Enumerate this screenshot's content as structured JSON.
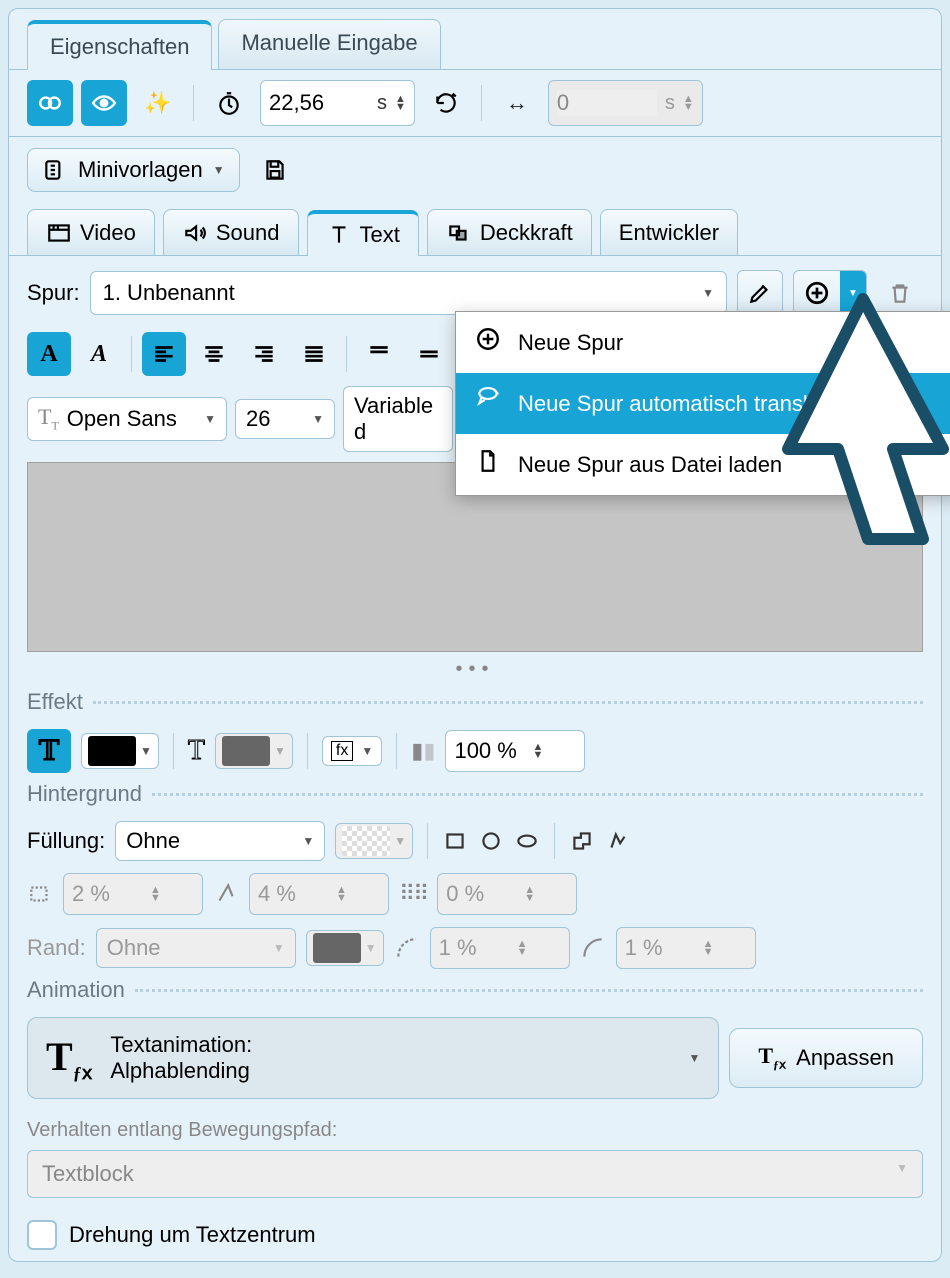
{
  "tabs": {
    "properties": "Eigenschaften",
    "manual": "Manuelle Eingabe"
  },
  "toolbar": {
    "duration_value": "22,56",
    "duration_unit": "s",
    "second_value": "0",
    "second_unit": "s"
  },
  "mini_templates": "Minivorlagen",
  "subtabs": {
    "video": "Video",
    "sound": "Sound",
    "text": "Text",
    "opacity": "Deckkraft",
    "developer": "Entwickler"
  },
  "spur": {
    "label": "Spur:",
    "value": "1. Unbenannt"
  },
  "menu": {
    "new": "Neue Spur",
    "auto": "Neue Spur automatisch transkribieren",
    "file": "Neue Spur aus Datei laden"
  },
  "font": {
    "family": "Open Sans",
    "size": "26",
    "variable": "Variable d"
  },
  "effect": {
    "label": "Effekt",
    "opacity": "100 %"
  },
  "background": {
    "label": "Hintergrund",
    "fill_label": "Füllung:",
    "fill_value": "Ohne",
    "blur": "2 %",
    "shadow": "4 %",
    "scatter": "0 %",
    "border_label": "Rand:",
    "border_value": "Ohne",
    "corner1": "1 %",
    "corner2": "1 %"
  },
  "animation": {
    "label": "Animation",
    "title": "Textanimation:",
    "name": "Alphablending",
    "adjust": "Anpassen",
    "path_label": "Verhalten entlang Bewegungspfad:",
    "path_value": "Textblock",
    "rotate": "Drehung um Textzentrum"
  }
}
